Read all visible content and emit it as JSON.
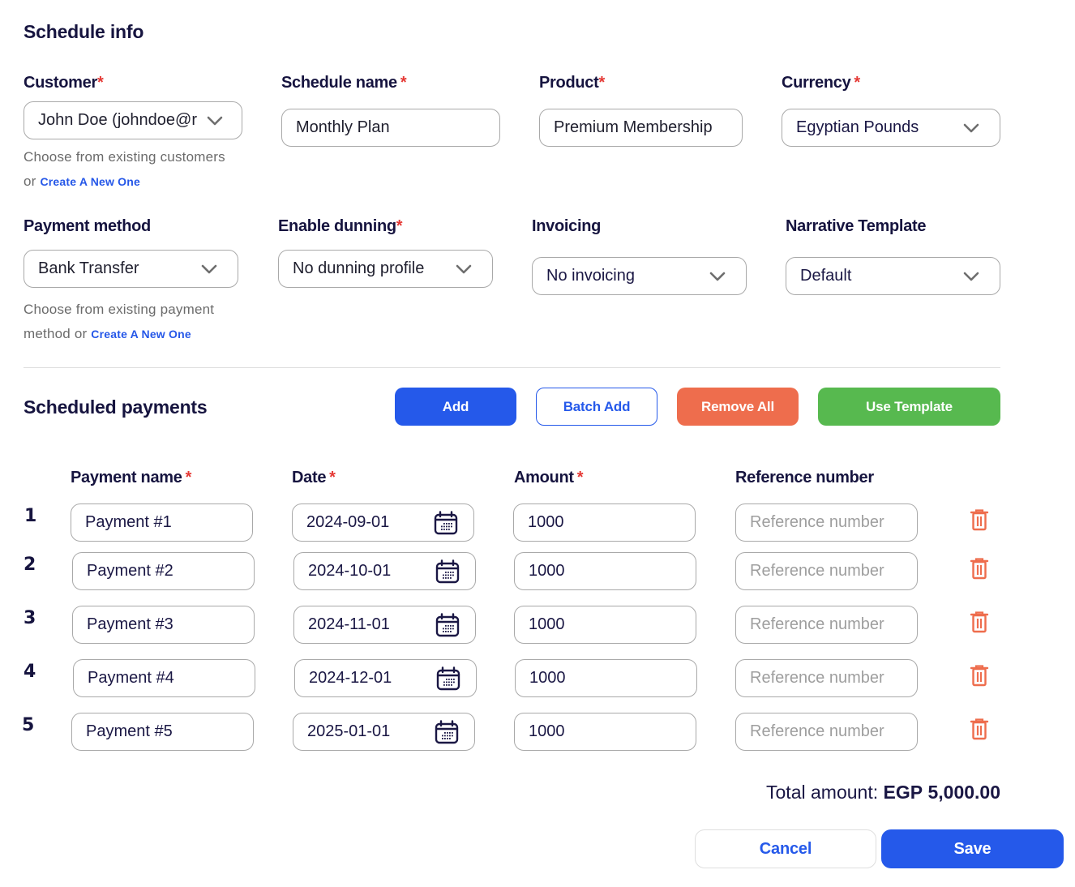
{
  "schedule_info": {
    "title": "Schedule info",
    "customer": {
      "label": "Customer",
      "required": "*",
      "value": "John Doe (johndoe@r",
      "helper_text": "Choose from existing customers",
      "helper_or": "or",
      "create_link": "Create A New One"
    },
    "schedule_name": {
      "label": "Schedule name",
      "required": "*",
      "value": "Monthly Plan"
    },
    "product": {
      "label": "Product",
      "required": "*",
      "value": "Premium Membership"
    },
    "currency": {
      "label": "Currency",
      "required": "*",
      "value": "Egyptian Pounds"
    },
    "payment_method": {
      "label": "Payment method",
      "value": "Bank Transfer",
      "helper_text_line1": "Choose from existing payment",
      "helper_text_line2": "method or",
      "create_link": "Create A New One"
    },
    "enable_dunning": {
      "label": "Enable dunning",
      "required": "*",
      "value": "No dunning profile"
    },
    "invoicing": {
      "label": "Invoicing",
      "value": "No invoicing"
    },
    "narrative_template": {
      "label": "Narrative Template",
      "value": "Default"
    }
  },
  "scheduled_payments": {
    "title": "Scheduled payments",
    "buttons": {
      "add": "Add",
      "batch_add": "Batch Add",
      "remove_all": "Remove All",
      "use_template": "Use Template"
    },
    "columns": {
      "payment_name": "Payment name",
      "date": "Date",
      "amount": "Amount",
      "reference_number": "Reference number",
      "required": "*"
    },
    "reference_placeholder": "Reference number",
    "rows": [
      {
        "index": "1",
        "name": "Payment #1",
        "date": "2024-09-01",
        "amount": "1000",
        "reference": ""
      },
      {
        "index": "2",
        "name": "Payment #2",
        "date": "2024-10-01",
        "amount": "1000",
        "reference": ""
      },
      {
        "index": "3",
        "name": "Payment #3",
        "date": "2024-11-01",
        "amount": "1000",
        "reference": ""
      },
      {
        "index": "4",
        "name": "Payment #4",
        "date": "2024-12-01",
        "amount": "1000",
        "reference": ""
      },
      {
        "index": "5",
        "name": "Payment #5",
        "date": "2025-01-01",
        "amount": "1000",
        "reference": ""
      }
    ],
    "total_label": "Total amount:",
    "total_currency": "EGP",
    "total_value": "5,000.00"
  },
  "footer": {
    "cancel": "Cancel",
    "save": "Save"
  },
  "colors": {
    "primary": "#2559ea",
    "danger": "#ee6d4d",
    "success": "#57b94f",
    "required": "#e53935",
    "heading": "#16143f"
  }
}
